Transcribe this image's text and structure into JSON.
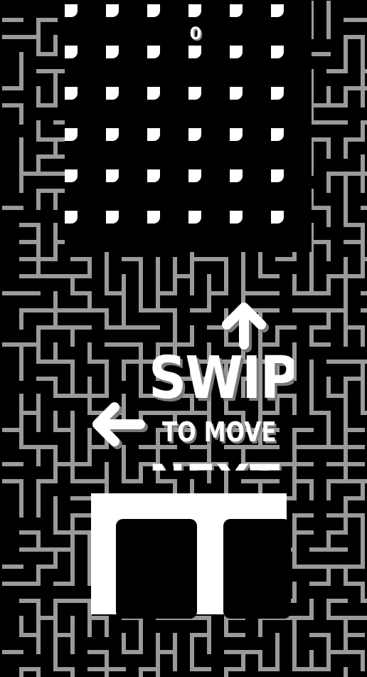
{
  "game": {
    "score": "0",
    "tutorial": {
      "line1": "SWIPE",
      "line2": "TO MOVE",
      "line3": "NEXT P"
    },
    "colors": {
      "background": "#000000",
      "maze_wall": "#9a9a9a",
      "dots": "#ffffff",
      "piece": "#ffffff",
      "text_shadow": "#7a7a7a"
    },
    "icons": {
      "up_arrow": "arrow-up-icon",
      "left_arrow": "arrow-left-icon"
    },
    "board": {
      "dot_rows": 6,
      "dot_cols": 6
    }
  }
}
